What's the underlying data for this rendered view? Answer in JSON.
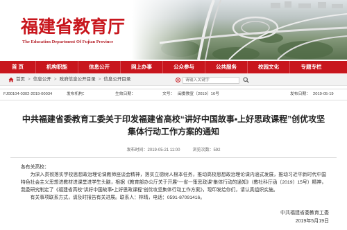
{
  "site": {
    "title": "福建省教育厅",
    "subtitle": "The Education Department Of Fujian Province"
  },
  "nav": {
    "items": [
      {
        "label": "首 页"
      },
      {
        "label": "机构职能"
      },
      {
        "label": "信息公开"
      },
      {
        "label": "网上办事"
      },
      {
        "label": "公众参与"
      },
      {
        "label": "公共服务"
      },
      {
        "label": "校园文化"
      },
      {
        "label": "专题专栏"
      }
    ]
  },
  "breadcrumb": {
    "separator": ">",
    "items": [
      "首页",
      "信息公开",
      "政府信息公开目录",
      "信息公开目录"
    ]
  },
  "search": {
    "placeholder": "请输入关键字"
  },
  "info": {
    "index_no": "FJ00104-0302-2019-00034",
    "publisher_label": "发布机构：",
    "effective_label": "生效日期：",
    "doc_no_label": "文号：",
    "doc_no": "闽委教宣〔2019〕16号",
    "date_label": "发布日期：",
    "date": "2019-05-19"
  },
  "article": {
    "title_lines": [
      "中共福建省委教育工委关于印发福建省高校“讲好中国故事•上好思政课程”创优攻坚",
      "集体行动工作方案的通知"
    ],
    "meta": {
      "time_label": "发布时间：",
      "time": "2019-05-21 11:00",
      "views_label": "浏览次数：",
      "views": "592"
    },
    "salutation": "各有关高校：",
    "paragraphs": [
      "为深入贯彻落实学校思想政治理论课教师座谈会精神，落实立德树人根本任务，推动高校思想政治理论课内涵式发展，推动习近平新时代中国特色社会主义思想进教材进课堂进学生头脑，根据《教育部办公厅关于开展“一省一策思政课”集体行动的通知》（教社科厅函〔2019〕15号）精神，我委研究制定了《福建省高校“讲好中国故事•上好思政课程”创优攻坚集体行动工作方案》，现印发给你们，请认真组织实施。",
      "有关事项联系方式，请及时报告有关进展。联系人：林晴，电话：0591-87091416。"
    ],
    "signature": {
      "org": "中共福建省委教育工委",
      "date": "2019年5月19日"
    }
  },
  "icons": {
    "breadcrumb": "home-icon",
    "search_scope": "target-icon",
    "search_button": "search-icon"
  },
  "colors": {
    "brand_red": "#c8161d",
    "bar_gray": "#f2f2f2"
  }
}
